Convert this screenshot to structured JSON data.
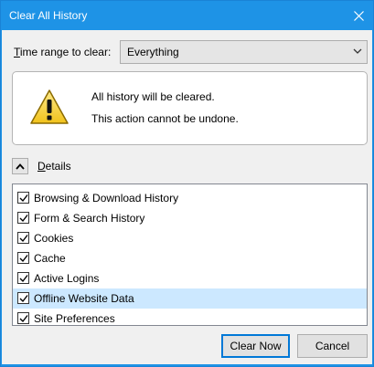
{
  "window": {
    "title": "Clear All History"
  },
  "time_range": {
    "label_prefix": "",
    "label_accel": "T",
    "label_rest": "ime range to clear:",
    "selected": "Everything"
  },
  "warning": {
    "line1": "All history will be cleared.",
    "line2": "This action cannot be undone.",
    "icon": "warning-triangle-icon"
  },
  "details": {
    "label_accel": "D",
    "label_rest": "etails",
    "expanded": true,
    "items": [
      {
        "label": "Browsing & Download History",
        "checked": true,
        "selected": false
      },
      {
        "label": "Form & Search History",
        "checked": true,
        "selected": false
      },
      {
        "label": "Cookies",
        "checked": true,
        "selected": false
      },
      {
        "label": "Cache",
        "checked": true,
        "selected": false
      },
      {
        "label": "Active Logins",
        "checked": true,
        "selected": false
      },
      {
        "label": "Offline Website Data",
        "checked": true,
        "selected": true
      },
      {
        "label": "Site Preferences",
        "checked": true,
        "selected": false
      }
    ]
  },
  "buttons": {
    "clear_now": "Clear Now",
    "cancel": "Cancel"
  },
  "colors": {
    "titlebar": "#1e93e6",
    "selection": "#cce8ff",
    "default_button_border": "#0078d7"
  }
}
